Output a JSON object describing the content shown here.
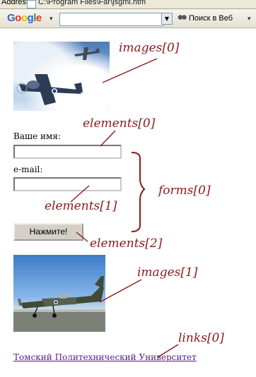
{
  "browser": {
    "address_label": "Address",
    "address_value": "C:\\Program Files\\Far\\jsgml.htm",
    "google_logo": [
      {
        "ch": "G",
        "color": "#3366cc"
      },
      {
        "ch": "o",
        "color": "#dd3333"
      },
      {
        "ch": "o",
        "color": "#eebb00"
      },
      {
        "ch": "g",
        "color": "#3366cc"
      },
      {
        "ch": "l",
        "color": "#339933"
      },
      {
        "ch": "e",
        "color": "#dd3333"
      }
    ],
    "search_value": "",
    "search_web_label": "Поиск в Веб"
  },
  "page": {
    "form": {
      "name_label": "Ваше имя:",
      "name_value": "",
      "email_label": "e-mail:",
      "email_value": "",
      "submit_label": "Нажмите!"
    },
    "link_text": "Томский Политехнический Университет"
  },
  "annotations": {
    "images0": "images[0]",
    "elements0": "elements[0]",
    "forms0": "forms[0]",
    "elements1": "elements[1]",
    "elements2": "elements[2]",
    "images1": "images[1]",
    "links0": "links[0]"
  },
  "colors": {
    "annotation": "#8b1a1a",
    "link_visited": "#551a8b"
  }
}
